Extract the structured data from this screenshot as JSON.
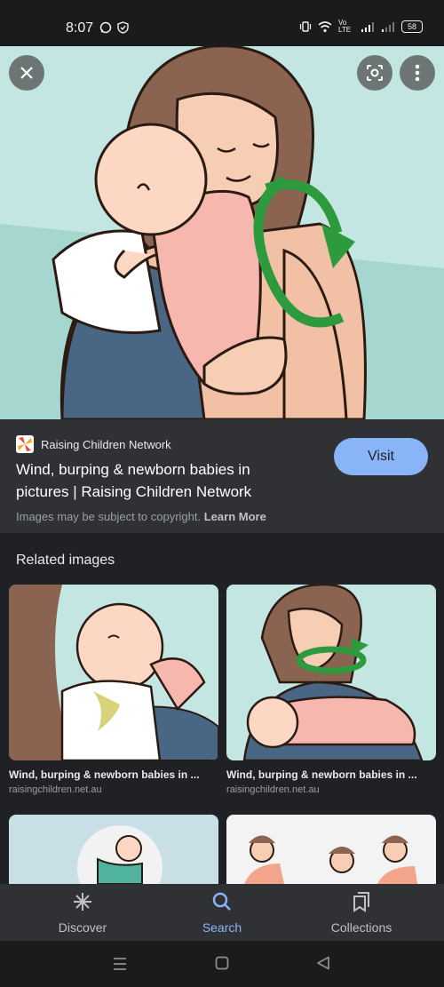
{
  "status_bar": {
    "time": "8:07",
    "battery": "58",
    "net_label": "Vo LTE"
  },
  "hero": {
    "close_icon": "close-icon",
    "lens_icon": "lens-icon",
    "more_icon": "more-vert-icon"
  },
  "result": {
    "source_name": "Raising Children Network",
    "title": "Wind, burping & newborn babies in pictures | Raising Children Network",
    "visit_label": "Visit",
    "copyright_text": "Images may be subject to copyright.",
    "learn_more": "Learn More"
  },
  "related": {
    "heading": "Related images",
    "items": [
      {
        "title": "Wind, burping & newborn babies in ...",
        "url": "raisingchildren.net.au"
      },
      {
        "title": "Wind, burping & newborn babies in ...",
        "url": "raisingchildren.net.au"
      }
    ]
  },
  "nav": {
    "items": [
      {
        "label": "Discover",
        "icon": "discover-icon"
      },
      {
        "label": "Search",
        "icon": "search-icon"
      },
      {
        "label": "Collections",
        "icon": "collections-icon"
      }
    ],
    "active": "Search",
    "accent": "#8ab4f8"
  }
}
